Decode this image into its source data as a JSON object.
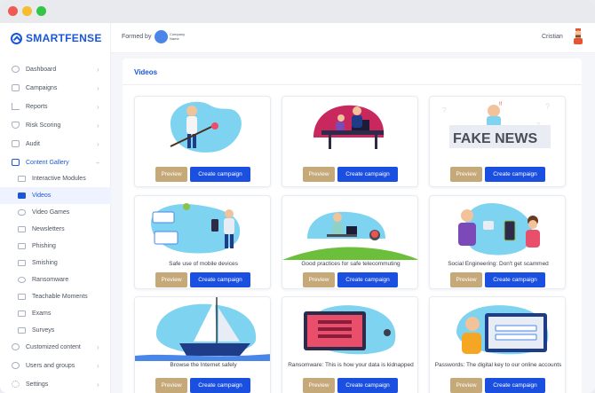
{
  "app": {
    "brand": "SMARTFENSE",
    "formed_by": "Formed by",
    "company_name": "Company Name",
    "user": "Cristian"
  },
  "sidebar": {
    "items": [
      {
        "label": "Dashboard",
        "icon": "speedometer-icon"
      },
      {
        "label": "Campaigns",
        "icon": "calendar-icon"
      },
      {
        "label": "Reports",
        "icon": "line-chart-icon"
      },
      {
        "label": "Risk Scoring",
        "icon": "shield-icon"
      },
      {
        "label": "Audit",
        "icon": "clipboard-icon"
      },
      {
        "label": "Content Gallery",
        "icon": "gallery-icon"
      }
    ],
    "sub_items": [
      {
        "label": "Interactive Modules",
        "icon": "image-icon"
      },
      {
        "label": "Videos",
        "icon": "video-icon"
      },
      {
        "label": "Video Games",
        "icon": "gamepad-icon"
      },
      {
        "label": "Newsletters",
        "icon": "newsletter-icon"
      },
      {
        "label": "Phishing",
        "icon": "mail-icon"
      },
      {
        "label": "Smishing",
        "icon": "sms-icon"
      },
      {
        "label": "Ransomware",
        "icon": "bug-icon"
      },
      {
        "label": "Teachable Moments",
        "icon": "book-icon"
      },
      {
        "label": "Exams",
        "icon": "exam-icon"
      },
      {
        "label": "Surveys",
        "icon": "survey-icon"
      }
    ],
    "bottom_items": [
      {
        "label": "Customized content",
        "icon": "plus-circle-icon"
      },
      {
        "label": "Users and groups",
        "icon": "users-icon"
      },
      {
        "label": "Settings",
        "icon": "gear-icon"
      }
    ]
  },
  "main": {
    "title": "Videos",
    "preview_label": "Preview",
    "create_label": "Create campaign",
    "cards": [
      {
        "caption": ""
      },
      {
        "caption": ""
      },
      {
        "caption": "",
        "image_text": "FAKE NEWS"
      },
      {
        "caption": "Safe use of mobile devices"
      },
      {
        "caption": "Good practices for safe telecommuting"
      },
      {
        "caption": "Social Engineering: Don't get scammed"
      },
      {
        "caption": "Browse the Internet safely"
      },
      {
        "caption": "Ransomware: This is how your data is kidnapped"
      },
      {
        "caption": "Passwords: The digital key to our online accounts"
      }
    ]
  },
  "colors": {
    "brand": "#1a57d6",
    "preview": "#c6a978",
    "create": "#1a4fe0",
    "illustration_blob": "#7dd3f0"
  }
}
